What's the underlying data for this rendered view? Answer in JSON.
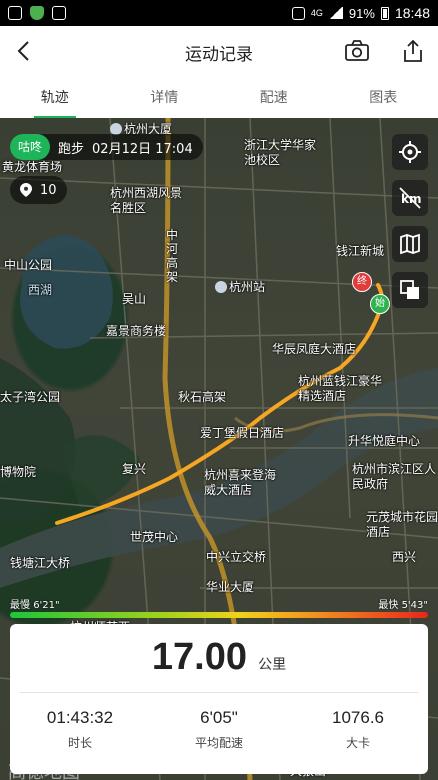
{
  "status_bar": {
    "network": "4G",
    "battery": "91%",
    "time": "18:48"
  },
  "header": {
    "title": "运动记录"
  },
  "tabs": [
    {
      "label": "轨迹",
      "active": true
    },
    {
      "label": "详情",
      "active": false
    },
    {
      "label": "配速",
      "active": false
    },
    {
      "label": "图表",
      "active": false
    }
  ],
  "run": {
    "app_badge": "咕咚",
    "type": "跑步",
    "date": "02月12日 17:04"
  },
  "map": {
    "photo_count": "10",
    "start_marker": "始",
    "end_marker": "终",
    "slowest_label": "最慢",
    "slowest_pace": "6'21\"",
    "fastest_label": "最快",
    "fastest_pace": "5'43\"",
    "route_color": "#f5a623",
    "pace_colors": [
      "#1ec53a",
      "#f0d21b",
      "#e7271b"
    ],
    "watermark": "高德地图",
    "labels": [
      "杭州大厦",
      "黄龙体育场",
      "浙江大学华家池校区",
      "杭州西湖风景名胜区",
      "中河高架",
      "钱江新城",
      "中山公园",
      "西湖",
      "杭州站",
      "嘉景商务楼",
      "华辰凤庭大酒店",
      "太子湾公园",
      "秋石高架",
      "杭州蓝钱江豪华精选酒店",
      "爱丁堡假日酒店",
      "升华悦庭中心",
      "博物院",
      "复兴",
      "杭州喜来登海威大酒店",
      "杭州市滨江区人民政府",
      "世茂中心",
      "元茂城市花园酒店",
      "钱塘江大桥",
      "中兴立交桥",
      "华业大厦",
      "西兴",
      "大狼山",
      "杭州师范西",
      "吴山"
    ]
  },
  "stats": {
    "distance": "17.00",
    "distance_unit": "公里",
    "duration": "01:43:32",
    "duration_label": "时长",
    "avg_pace": "6'05\"",
    "avg_pace_label": "平均配速",
    "calories": "1076.6",
    "calories_label": "大卡"
  },
  "icons": [
    "back-icon",
    "camera-icon",
    "share-icon",
    "locate-icon",
    "km-icon",
    "map-icon",
    "layers-icon",
    "photo-pin-icon"
  ]
}
